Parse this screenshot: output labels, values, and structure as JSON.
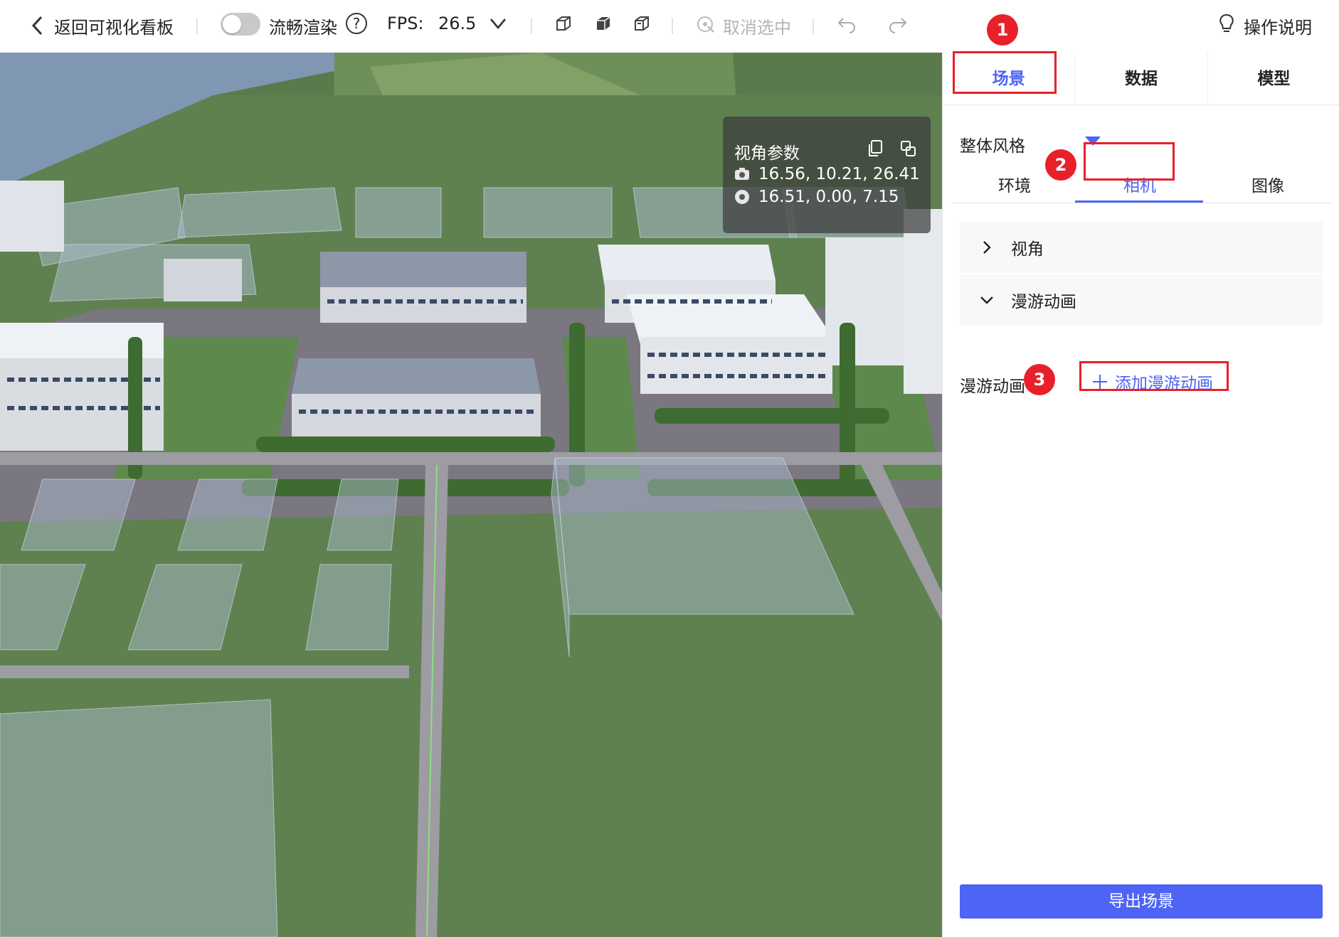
{
  "toolbar": {
    "back_label": "返回可视化看板",
    "smooth_label": "流畅渲染",
    "help_glyph": "?",
    "fps_label": "FPS:",
    "fps_value": "26.5",
    "deselect_label": "取消选中",
    "guide_label": "操作说明"
  },
  "camera_panel": {
    "title": "视角参数",
    "camera_position": "16.56, 10.21, 26.41",
    "target_position": "16.51, 0.00, 7.15"
  },
  "panel": {
    "main_tabs": [
      {
        "label": "场景",
        "active": true
      },
      {
        "label": "数据",
        "active": false
      },
      {
        "label": "模型",
        "active": false
      }
    ],
    "style_label": "整体风格",
    "sub_tabs": [
      {
        "label": "环境",
        "active": false
      },
      {
        "label": "相机",
        "active": true
      },
      {
        "label": "图像",
        "active": false
      }
    ],
    "sections": [
      {
        "label": "视角",
        "expanded": false
      },
      {
        "label": "漫游动画",
        "expanded": true
      }
    ],
    "roam_label": "漫游动画",
    "add_roam_label": "添加漫游动画",
    "export_label": "导出场景"
  },
  "badges": [
    "1",
    "2",
    "3"
  ],
  "colors": {
    "accent": "#4d64f5",
    "annotation_red": "#e8202a"
  }
}
